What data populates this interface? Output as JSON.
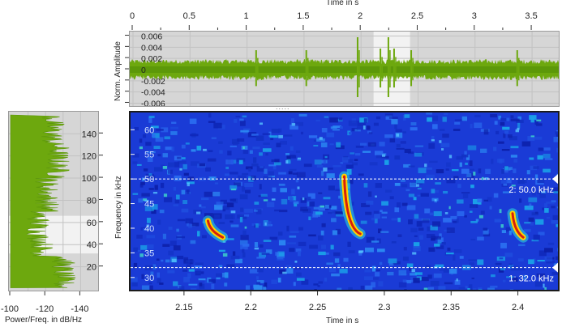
{
  "waveform": {
    "x_axis_title": "Time in s",
    "y_axis_title": "Norm. Amplitude",
    "x_ticks": [
      "0",
      "0.5",
      "1",
      "1.5",
      "2",
      "2.5",
      "3",
      "3.5"
    ],
    "x_tick_values": [
      0,
      0.5,
      1,
      1.5,
      2,
      2.5,
      3,
      3.5
    ],
    "x_range": [
      0,
      3.72
    ],
    "y_ticks": [
      "0.006",
      "0.004",
      "0.002",
      "0",
      "-0.002",
      "-0.004",
      "-0.006"
    ],
    "y_tick_values": [
      0.006,
      0.004,
      0.002,
      0,
      -0.002,
      -0.004,
      -0.006
    ],
    "y_range": [
      -0.0068,
      0.0068
    ],
    "selection": [
      2.11,
      2.43
    ],
    "bursts": [
      1.08,
      1.52,
      1.97,
      2.17,
      2.24,
      2.29,
      2.44,
      3.37
    ],
    "colors": {
      "background": "#d6d6d6",
      "selection": "#f2f2f2",
      "signal": "#6da80e",
      "signal_dark": "#4f8a06"
    }
  },
  "spectrum": {
    "x_axis_title": "Power/Freq. in dB/Hz",
    "x_ticks": [
      "-100",
      "-120",
      "-140"
    ],
    "x_tick_values": [
      -100,
      -120,
      -140
    ],
    "x_range": [
      -100,
      -150
    ],
    "y_ticks": [
      "140",
      "120",
      "100",
      "80",
      "60",
      "40",
      "20"
    ],
    "y_tick_values": [
      140,
      120,
      100,
      80,
      60,
      40,
      20
    ],
    "y_range": [
      0,
      157
    ],
    "selection_khz": [
      32,
      66
    ],
    "colors": {
      "background": "#d6d6d6",
      "selection": "#f2f2f2",
      "signal": "#6da80e"
    }
  },
  "spectrogram": {
    "x_axis_title": "Time in s",
    "y_axis_title": "Frequency in kHz",
    "x_ticks": [
      "2.15",
      "2.2",
      "2.25",
      "2.3",
      "2.35",
      "2.4"
    ],
    "x_tick_values": [
      2.15,
      2.2,
      2.25,
      2.3,
      2.35,
      2.4
    ],
    "x_range": [
      2.11,
      2.43
    ],
    "y_ticks": [
      "60",
      "55",
      "50",
      "45",
      "40",
      "35",
      "30"
    ],
    "y_tick_values": [
      60,
      55,
      50,
      45,
      40,
      35,
      30
    ],
    "y_range": [
      27.5,
      63.5
    ],
    "markers": [
      {
        "label": "2: 50.0 kHz",
        "khz": 50.0
      },
      {
        "label": "1: 32.0 kHz",
        "khz": 32.0
      }
    ],
    "colors": {
      "background": "#1a3bd6",
      "marker": "#ffffff"
    }
  },
  "splitter_handle": "....."
}
